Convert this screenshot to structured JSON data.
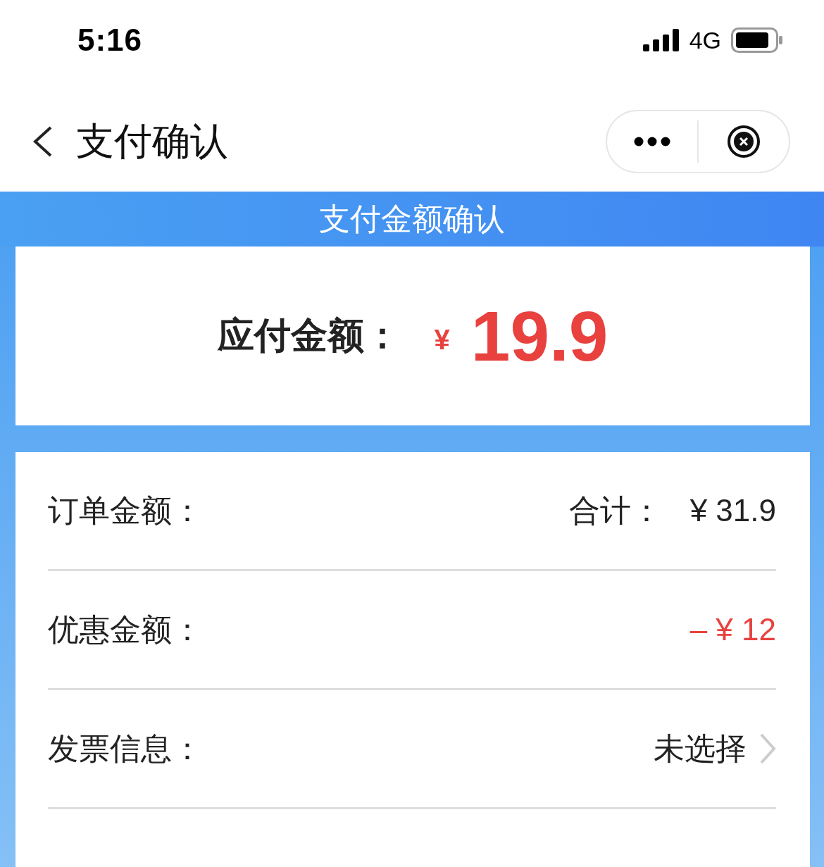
{
  "status_bar": {
    "time": "5:16",
    "network": "4G"
  },
  "nav": {
    "title": "支付确认"
  },
  "banner": {
    "title": "支付金额确认"
  },
  "amount_due": {
    "label": "应付金额：",
    "currency": "¥",
    "amount": "19.9"
  },
  "details": [
    {
      "kind": "total",
      "label": "订单金额：",
      "prefix": "合计：",
      "value": "¥ 31.9"
    },
    {
      "kind": "discount",
      "label": "优惠金额：",
      "value": "– ¥ 12"
    },
    {
      "kind": "link",
      "label": "发票信息：",
      "value": "未选择"
    }
  ]
}
